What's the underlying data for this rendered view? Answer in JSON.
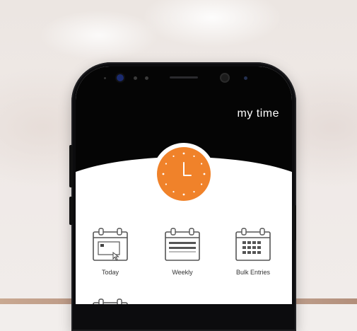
{
  "app": {
    "title": "my time"
  },
  "tiles": [
    {
      "label": "Today",
      "icon": "calendar-today-icon"
    },
    {
      "label": "Weekly",
      "icon": "calendar-weekly-icon"
    },
    {
      "label": "Bulk Entries",
      "icon": "calendar-grid-icon"
    }
  ],
  "colors": {
    "accent": "#f0822a",
    "header": "#050505",
    "screen": "#ffffff"
  }
}
